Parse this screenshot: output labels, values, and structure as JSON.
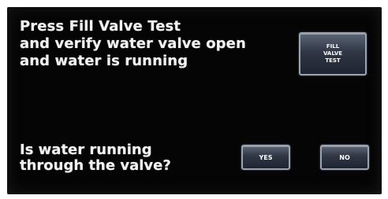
{
  "instruction": {
    "text": "Press Fill Valve Test\nand verify water valve open\nand water is running"
  },
  "fill_valve_button": {
    "label": "FILL\nVALVE\nTEST"
  },
  "question": {
    "text": "Is water running\nthrough the valve?"
  },
  "answer_buttons": {
    "yes_label": "YES",
    "no_label": "NO"
  },
  "colors": {
    "screen_background": "#050505",
    "text": "#f2f2f2",
    "button_border": "#9aa3b3",
    "button_fill": "#2f3644"
  }
}
